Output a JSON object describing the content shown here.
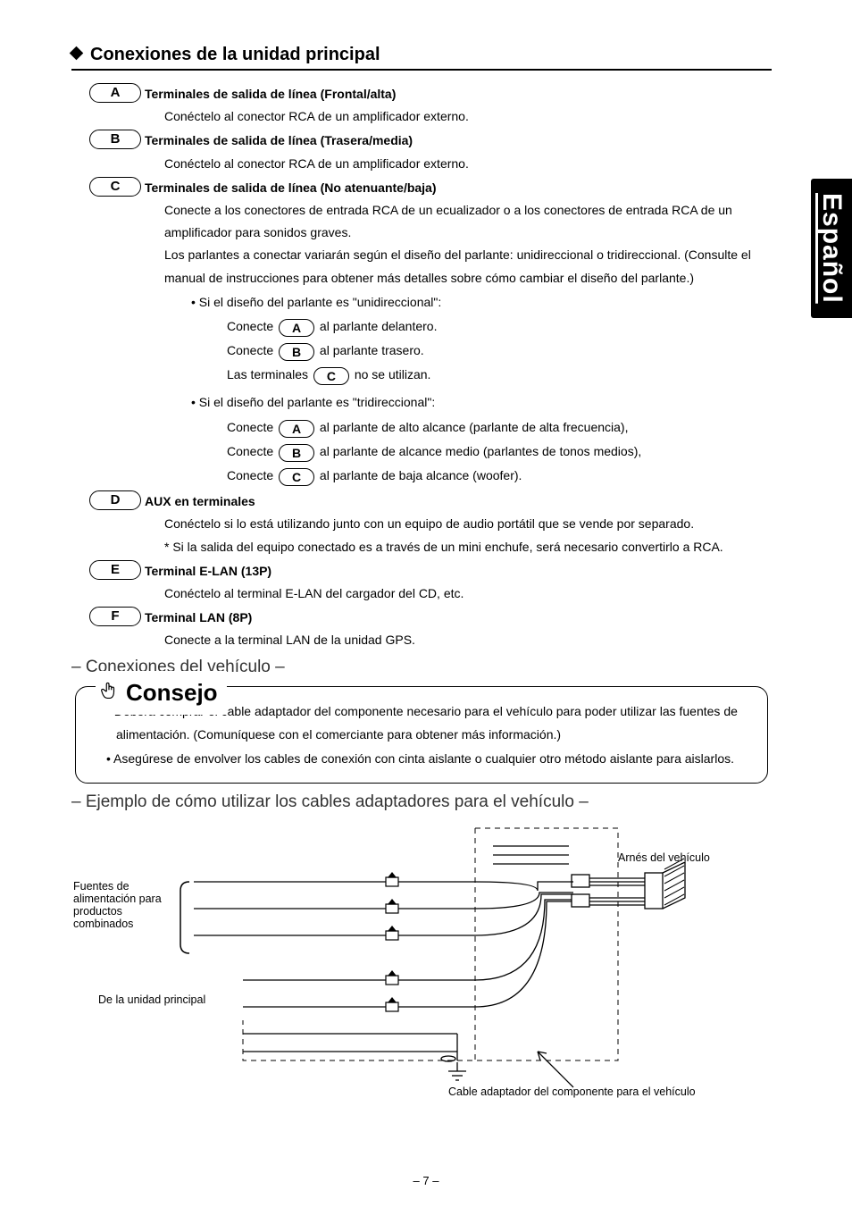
{
  "sideTab": "Español",
  "sectionTitle": "Conexiones de la unidad principal",
  "labels": {
    "A": "A",
    "B": "B",
    "C": "C",
    "D": "D",
    "E": "E",
    "F": "F"
  },
  "items": {
    "A": {
      "title": "Terminales de salida de línea (Frontal/alta)",
      "desc": "Conéctelo al conector RCA de un amplificador externo."
    },
    "B": {
      "title": "Terminales de salida de línea (Trasera/media)",
      "desc": "Conéctelo al conector RCA de un amplificador externo."
    },
    "C": {
      "title": "Terminales de salida de línea (No atenuante/baja)",
      "p1": "Conecte a los conectores de entrada RCA de un ecualizador o a los conectores de entrada RCA de un amplificador para sonidos graves.",
      "p2": "Los parlantes a conectar variarán según el diseño del parlante: unidireccional o tridireccional. (Consulte el manual de instrucciones para obtener más detalles sobre cómo cambiar el diseño del parlante.)",
      "uni": {
        "head": "Si el diseño del parlante es \"unidireccional\":",
        "a_pre": "Conecte ",
        "a_post": " al parlante delantero.",
        "b_pre": "Conecte ",
        "b_post": " al parlante trasero.",
        "c_pre": "Las terminales ",
        "c_post": " no se utilizan."
      },
      "tri": {
        "head": "Si el diseño del parlante es \"tridireccional\":",
        "a_pre": "Conecte ",
        "a_post": " al parlante de alto alcance (parlante de alta frecuencia),",
        "b_pre": "Conecte ",
        "b_post": " al parlante de alcance medio (parlantes de tonos medios),",
        "c_pre": "Conecte ",
        "c_post": " al parlante de baja alcance (woofer)."
      }
    },
    "D": {
      "title": "AUX en terminales",
      "p1": "Conéctelo si lo está utilizando junto con un equipo de audio portátil que se vende por separado.",
      "p2": "* Si la salida del equipo conectado es a través de un mini enchufe, será necesario convertirlo a RCA."
    },
    "E": {
      "title": "Terminal E-LAN (13P)",
      "desc": "Conéctelo al terminal E-LAN del cargador del CD, etc."
    },
    "F": {
      "title": "Terminal LAN (8P)",
      "desc": "Conecte a la terminal LAN de la unidad GPS."
    }
  },
  "vehicleHead": "– Conexiones del vehículo –",
  "tip": {
    "title": "Consejo",
    "b1": "Deberá comprar el cable adaptador del componente necesario para el vehículo para poder utilizar las fuentes de alimentación. (Comuníquese con el comerciante para obtener más información.)",
    "b2": "Asegúrese de envolver los cables de conexión con cinta aislante o cualquier otro método aislante para aislarlos."
  },
  "exampleHead": "– Ejemplo de cómo utilizar los cables adaptadores para el vehículo –",
  "diag": {
    "l1": "Fuentes de alimentación para productos combinados",
    "l2": "De la unidad principal",
    "l3": "Arnés del vehículo",
    "l4": "Cable adaptador del componente para el vehículo"
  },
  "pageNum": "– 7 –"
}
